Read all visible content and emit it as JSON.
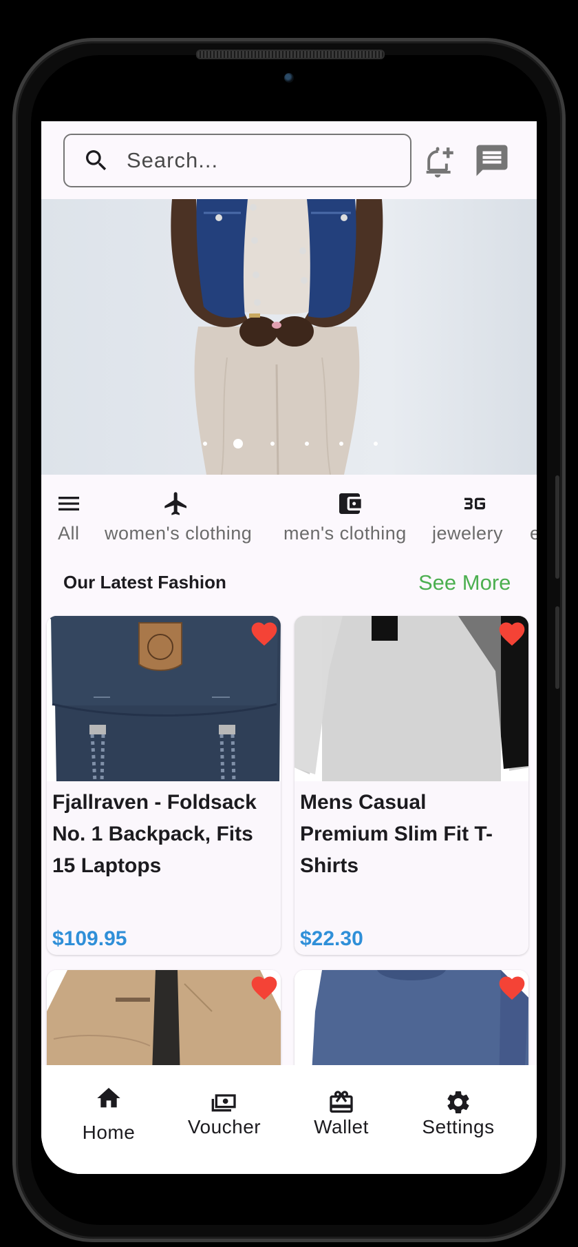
{
  "search": {
    "placeholder": "Search..."
  },
  "banner": {
    "slide_count": 6,
    "active_index": 1
  },
  "categories": [
    {
      "label": "All",
      "icon": "menu-icon"
    },
    {
      "label": "women's clothing",
      "icon": "airplane-icon"
    },
    {
      "label": "men's clothing",
      "icon": "wallet-icon"
    },
    {
      "label": "jewelery",
      "icon": "3g-icon"
    },
    {
      "label": "e",
      "icon": ""
    }
  ],
  "section": {
    "title": "Our Latest Fashion",
    "see_more": "See More"
  },
  "products": [
    {
      "title": "Fjallraven - Foldsack No. 1 Backpack, Fits 15 Laptops",
      "price": "$109.95",
      "favorite": true
    },
    {
      "title": "Mens Casual Premium Slim Fit T-Shirts",
      "price": "$22.30",
      "favorite": true
    },
    {
      "title": "",
      "price": "",
      "favorite": true
    },
    {
      "title": "",
      "price": "",
      "favorite": true
    }
  ],
  "nav": [
    {
      "label": "Home",
      "icon": "home-icon",
      "active": true
    },
    {
      "label": "Voucher",
      "icon": "voucher-icon"
    },
    {
      "label": "Wallet",
      "icon": "gift-card-icon"
    },
    {
      "label": "Settings",
      "icon": "gear-icon"
    }
  ],
  "colors": {
    "accent_green": "#4caf50",
    "price_blue": "#2f8fd8",
    "heart_red": "#f44336",
    "background": "#fcf8fd"
  }
}
